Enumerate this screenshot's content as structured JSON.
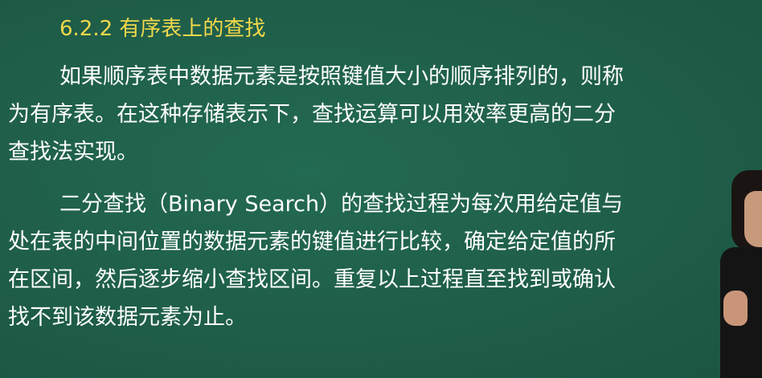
{
  "heading": "6.2.2 有序表上的查找",
  "paragraph1": {
    "lines": [
      "如果顺序表中数据元素是按照键值大小的顺序排列的，则称",
      "为有序表。在这种存储表示下，查找运算可以用效率更高的二分",
      "查找法实现。"
    ]
  },
  "paragraph2": {
    "lines": [
      "二分查找（Binary Search）的查找过程为每次用给定值与",
      "处在表的中间位置的数据元素的键值进行比较，确定给定值的所",
      "在区间，然后逐步缩小查找区间。重复以上过程直至找到或确认",
      "找不到该数据元素为止。"
    ]
  },
  "colors": {
    "background": "#1f5e49",
    "heading": "#f2d84b",
    "text": "#ffffff"
  }
}
